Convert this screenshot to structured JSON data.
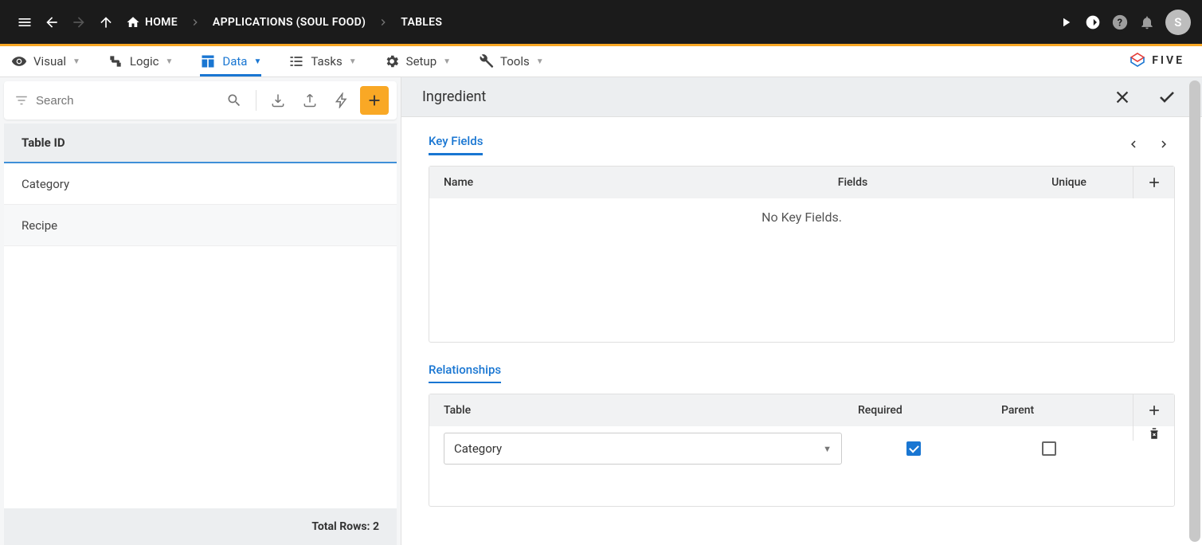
{
  "topbar": {
    "home": "HOME",
    "applications": "APPLICATIONS (SOUL FOOD)",
    "tables": "TABLES",
    "avatar": "S"
  },
  "menu": {
    "visual": "Visual",
    "logic": "Logic",
    "data": "Data",
    "tasks": "Tasks",
    "setup": "Setup",
    "tools": "Tools",
    "logo": "FIVE"
  },
  "left": {
    "search_placeholder": "Search",
    "header": "Table ID",
    "rows": [
      "Category",
      "Recipe"
    ],
    "footer": "Total Rows: 2"
  },
  "right": {
    "title": "Ingredient",
    "keyfields": {
      "label": "Key Fields",
      "cols": {
        "name": "Name",
        "fields": "Fields",
        "unique": "Unique"
      },
      "empty": "No Key Fields."
    },
    "relationships": {
      "label": "Relationships",
      "cols": {
        "table": "Table",
        "required": "Required",
        "parent": "Parent"
      },
      "rows": [
        {
          "table": "Category",
          "required": true,
          "parent": false
        }
      ]
    }
  }
}
